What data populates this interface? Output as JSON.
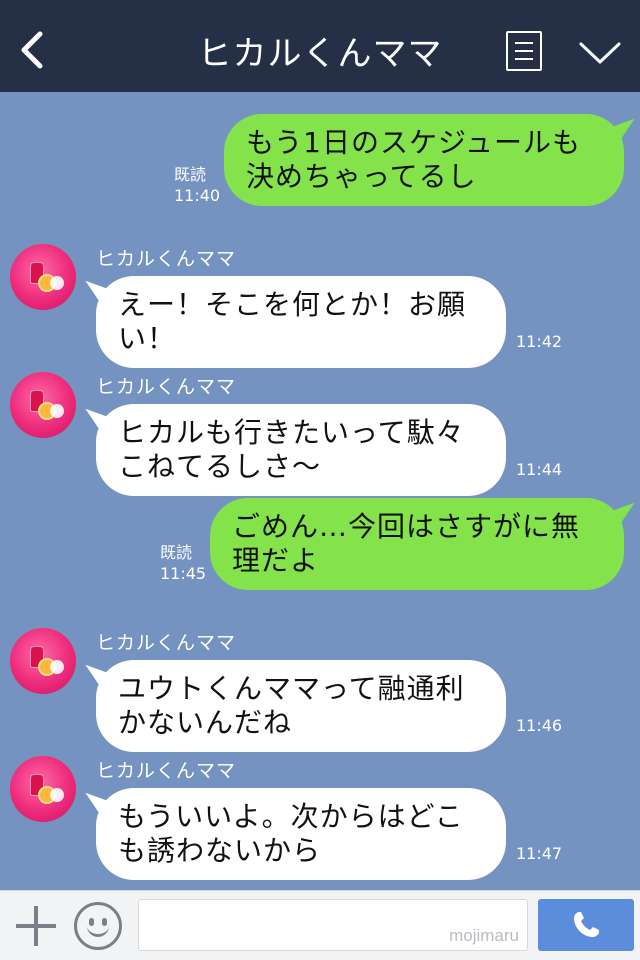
{
  "header": {
    "title": "ヒカルくんママ",
    "back_icon": "chevron-left-icon",
    "menu_icon": "list-icon",
    "collapse_icon": "chevron-down-icon"
  },
  "messages": [
    {
      "direction": "out",
      "lines": [
        "もう1日のスケジュールも",
        "決めちゃってるし"
      ],
      "read": "既読",
      "time": "11:40"
    },
    {
      "direction": "in",
      "sender": "ヒカルくんママ",
      "lines": [
        "えー！そこを何とか！お願",
        "い！"
      ],
      "time": "11:42"
    },
    {
      "direction": "in",
      "sender": "ヒカルくんママ",
      "lines": [
        "ヒカルも行きたいって駄々",
        "こねてるしさ〜"
      ],
      "time": "11:44"
    },
    {
      "direction": "out",
      "lines": [
        "ごめん…今回はさすがに無",
        "理だよ"
      ],
      "read": "既読",
      "time": "11:45"
    },
    {
      "direction": "in",
      "sender": "ヒカルくんママ",
      "lines": [
        "ユウトくんママって融通利",
        "かないんだね"
      ],
      "time": "11:46"
    },
    {
      "direction": "in",
      "sender": "ヒカルくんママ",
      "lines": [
        "もういいよ。次からはどこ",
        "も誘わないから"
      ],
      "time": "11:47"
    }
  ],
  "input_bar": {
    "plus_icon": "plus-icon",
    "emoji_icon": "emoji-icon",
    "watermark": "mojimaru",
    "call_icon": "phone-icon"
  },
  "colors": {
    "header_bg": "#253046",
    "chat_bg": "#7493c0",
    "outgoing_bubble": "#84e34b",
    "incoming_bubble": "#ffffff",
    "call_button": "#5b8ddc"
  }
}
